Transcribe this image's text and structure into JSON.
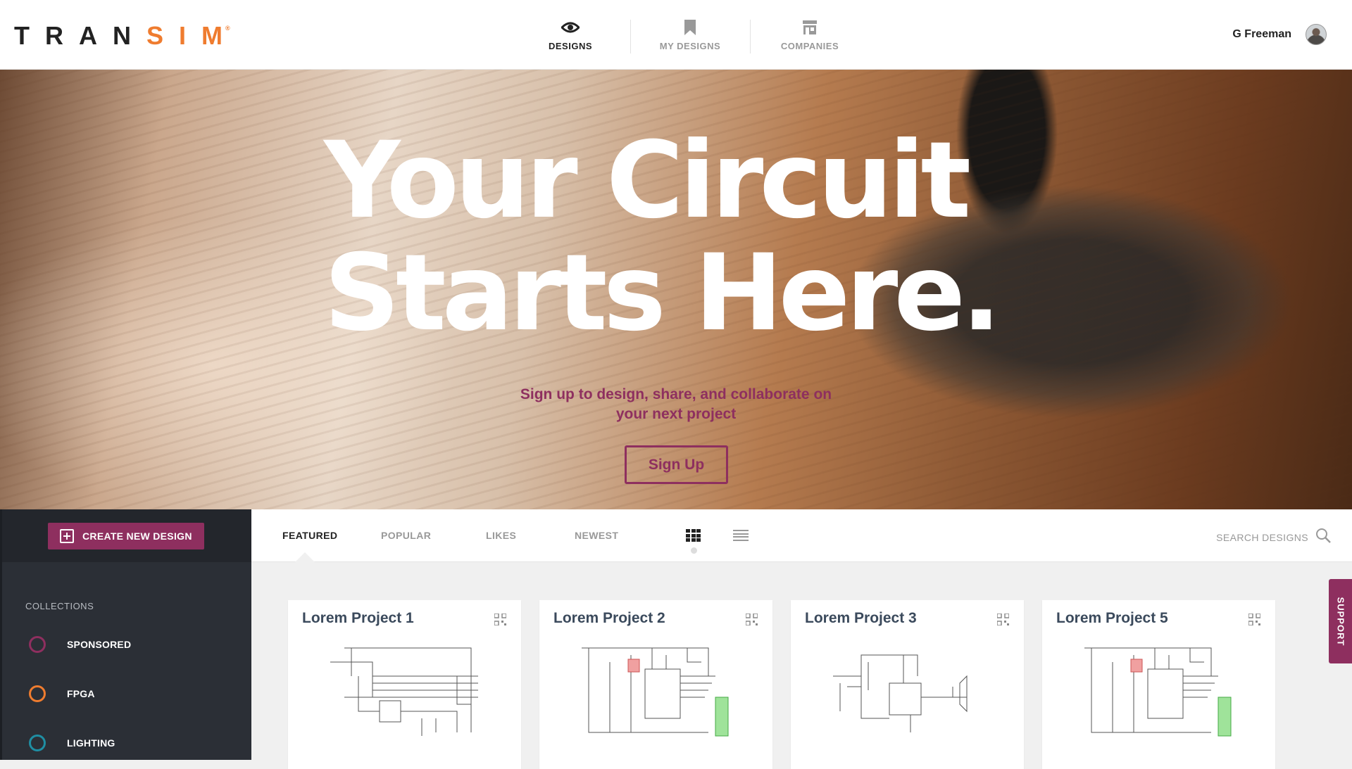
{
  "header": {
    "logo_main": "TRAN",
    "logo_accent": "SIM",
    "logo_reg": "®",
    "nav": [
      {
        "label": "DESIGNS",
        "icon": "eye-icon",
        "active": true
      },
      {
        "label": "MY DESIGNS",
        "icon": "bookmark-icon",
        "active": false
      },
      {
        "label": "COMPANIES",
        "icon": "store-icon",
        "active": false
      }
    ],
    "user_name": "G Freeman"
  },
  "hero": {
    "title_line1": "Your Circuit",
    "title_line2": "Starts Here.",
    "subtitle_line1": "Sign up to design, share, and collaborate on",
    "subtitle_line2": "your next project",
    "signup_label": "Sign Up"
  },
  "sidebar": {
    "create_label": "CREATE NEW DESIGN",
    "collections_title": "COLLECTIONS",
    "collections": [
      {
        "label": "SPONSORED",
        "color": "#8e2f5f"
      },
      {
        "label": "FPGA",
        "color": "#ef7c2f"
      },
      {
        "label": "LIGHTING",
        "color": "#1f8ea3"
      }
    ]
  },
  "toolbar": {
    "tabs": [
      "FEATURED",
      "POPULAR",
      "LIKES",
      "NEWEST"
    ],
    "active_tab": "FEATURED",
    "search_label": "SEARCH DESIGNS"
  },
  "cards": [
    {
      "title": "Lorem Project 1"
    },
    {
      "title": "Lorem Project 2"
    },
    {
      "title": "Lorem Project 3"
    },
    {
      "title": "Lorem Project 5"
    }
  ],
  "support_label": "SUPPORT",
  "colors": {
    "brand": "#8e2f5f",
    "accent": "#ef7c2f",
    "sidebar": "#2b2f36"
  }
}
